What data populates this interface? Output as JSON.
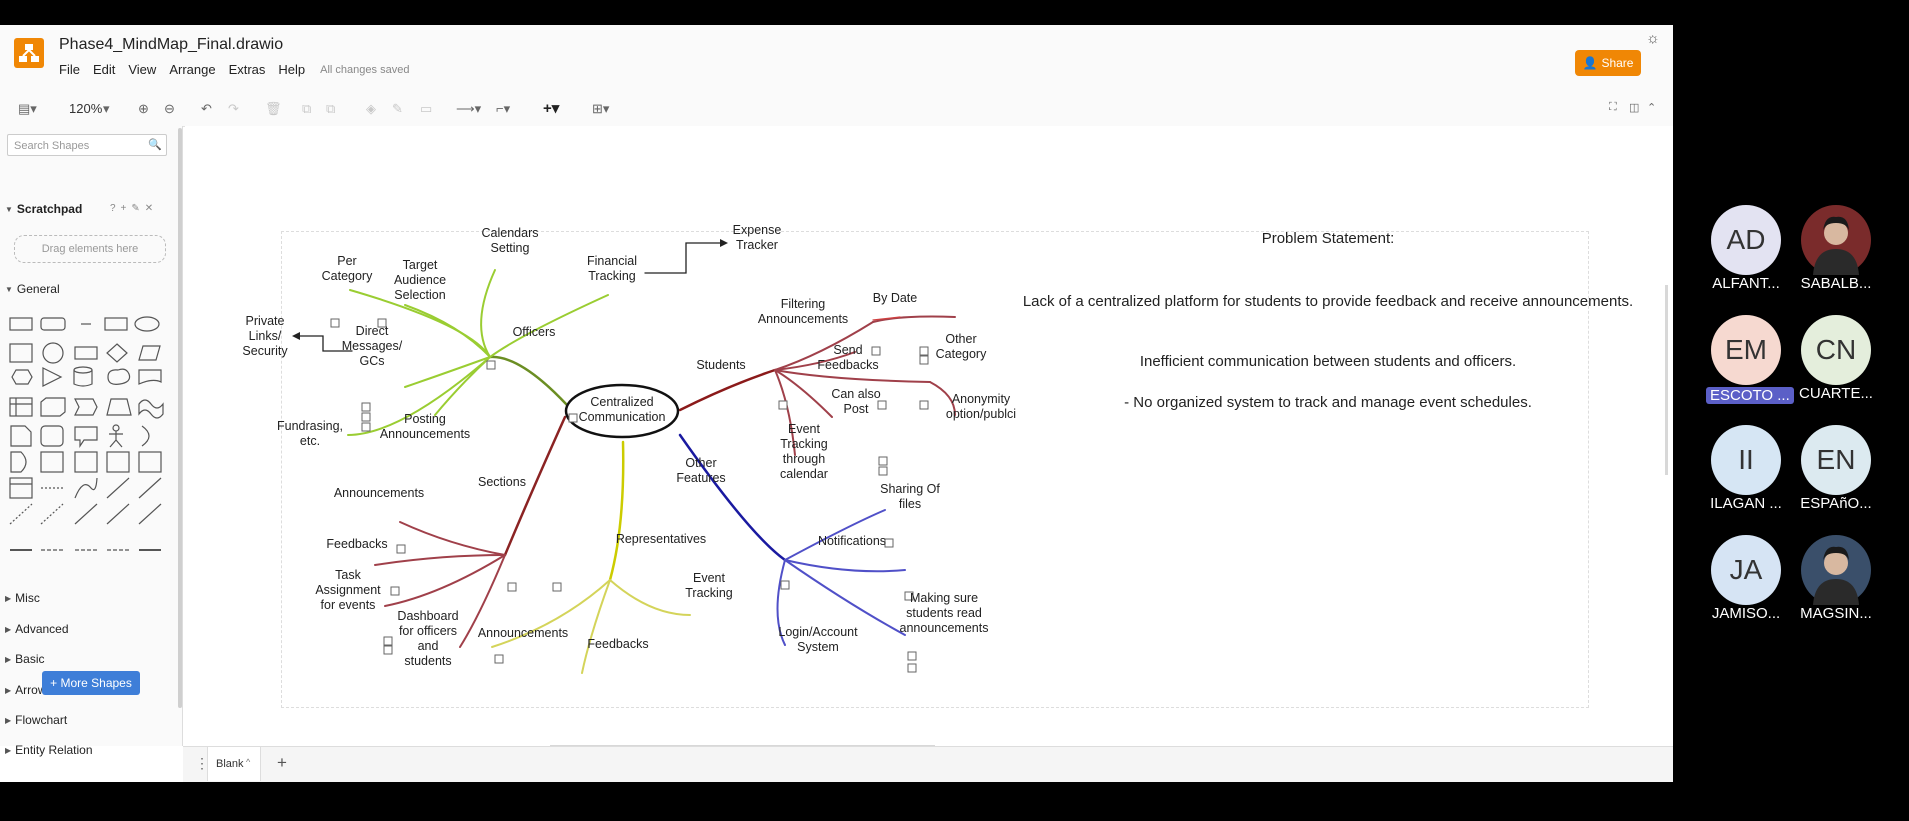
{
  "app": {
    "title": "Phase4_MindMap_Final.drawio",
    "menus": [
      "File",
      "Edit",
      "View",
      "Arrange",
      "Extras",
      "Help"
    ],
    "status": "All changes saved",
    "share_label": "Share"
  },
  "toolbar": {
    "zoom": "120%"
  },
  "sidebar": {
    "search_placeholder": "Search Shapes",
    "scratchpad_label": "Scratchpad",
    "drag_hint": "Drag elements here",
    "general_label": "General",
    "collapsed_sections": [
      "Misc",
      "Advanced",
      "Basic",
      "Arrows",
      "Flowchart",
      "Entity Relation"
    ],
    "more_shapes": "More Shapes"
  },
  "pages": {
    "tab_label": "Blank"
  },
  "mindmap": {
    "central": "Centralized\nCommunication",
    "nodes": [
      {
        "id": "calendars",
        "text": "Calendars\nSetting"
      },
      {
        "id": "per_category",
        "text": "Per\nCategory"
      },
      {
        "id": "target_audience",
        "text": "Target\nAudience\nSelection"
      },
      {
        "id": "financial",
        "text": "Financial\nTracking"
      },
      {
        "id": "expense",
        "text": "Expense\nTracker"
      },
      {
        "id": "private_links",
        "text": "Private\nLinks/\nSecurity"
      },
      {
        "id": "direct_messages",
        "text": "Direct\nMessages/\nGCs"
      },
      {
        "id": "officers",
        "text": "Officers"
      },
      {
        "id": "fundrasing",
        "text": "Fundrasing,\netc."
      },
      {
        "id": "posting",
        "text": "Posting\nAnnouncements"
      },
      {
        "id": "filtering",
        "text": "Filtering\nAnnouncements"
      },
      {
        "id": "by_date",
        "text": "By Date"
      },
      {
        "id": "other_category",
        "text": "Other\nCategory"
      },
      {
        "id": "students",
        "text": "Students"
      },
      {
        "id": "send_feedbacks",
        "text": "Send\nFeedbacks"
      },
      {
        "id": "anonymity",
        "text": "Anonymity\noption/publci"
      },
      {
        "id": "can_also_post",
        "text": "Can also\nPost"
      },
      {
        "id": "event_tracking_cal",
        "text": "Event\nTracking\nthrough\ncalendar"
      },
      {
        "id": "other_features",
        "text": "Other\nFeatures"
      },
      {
        "id": "sections",
        "text": "Sections"
      },
      {
        "id": "announcements_s",
        "text": "Announcements"
      },
      {
        "id": "feedbacks_s",
        "text": "Feedbacks"
      },
      {
        "id": "task_assignment",
        "text": "Task\nAssignment\nfor events"
      },
      {
        "id": "dashboard",
        "text": "Dashboard\nfor officers\nand\nstudents"
      },
      {
        "id": "representatives",
        "text": "Representatives"
      },
      {
        "id": "announcements_r",
        "text": "Announcements"
      },
      {
        "id": "feedbacks_r",
        "text": "Feedbacks"
      },
      {
        "id": "event_tracking",
        "text": "Event\nTracking"
      },
      {
        "id": "sharing",
        "text": "Sharing Of\nfiles"
      },
      {
        "id": "notifications",
        "text": "Notifications"
      },
      {
        "id": "making_sure",
        "text": "Making sure\nstudents read\nannouncements"
      },
      {
        "id": "login",
        "text": "Login/Account\nSystem"
      }
    ],
    "branch_colors": {
      "officers": "#6b8e23",
      "students": "#8b1a1a",
      "sections": "#8b2323",
      "representatives": "#cccc00",
      "features": "#1a1aa0",
      "sub_green": "#9acd32",
      "sub_red": "#a0404a",
      "sub_blue": "#5050c8",
      "sub_yellow": "#d4d45a"
    }
  },
  "problem_statement": {
    "heading": "Problem Statement:",
    "paragraph1": "Lack of a centralized platform for students to provide feedback and receive announcements.",
    "paragraph2": "Inefficient communication between students and officers.",
    "paragraph3": "- No organized system to track and manage event schedules."
  },
  "participants": [
    {
      "initials": "AD",
      "name": "ALFANT...",
      "color": "#e3e3f2",
      "photo": false
    },
    {
      "initials": "",
      "name": "SABALB...",
      "color": "#7a2b2b",
      "photo": true
    },
    {
      "initials": "EM",
      "name": "ESCOTO ...",
      "color": "#f6d9d0",
      "photo": false,
      "highlight": true
    },
    {
      "initials": "CN",
      "name": "CUARTE...",
      "color": "#e4eedc",
      "photo": false
    },
    {
      "initials": "II",
      "name": "ILAGAN ...",
      "color": "#d6e6f4",
      "photo": false
    },
    {
      "initials": "EN",
      "name": "ESPAñO...",
      "color": "#dceaf0",
      "photo": false
    },
    {
      "initials": "JA",
      "name": "JAMISO...",
      "color": "#d6e4f4",
      "photo": false
    },
    {
      "initials": "",
      "name": "MAGSIN...",
      "color": "#3a4f6a",
      "photo": true
    }
  ]
}
